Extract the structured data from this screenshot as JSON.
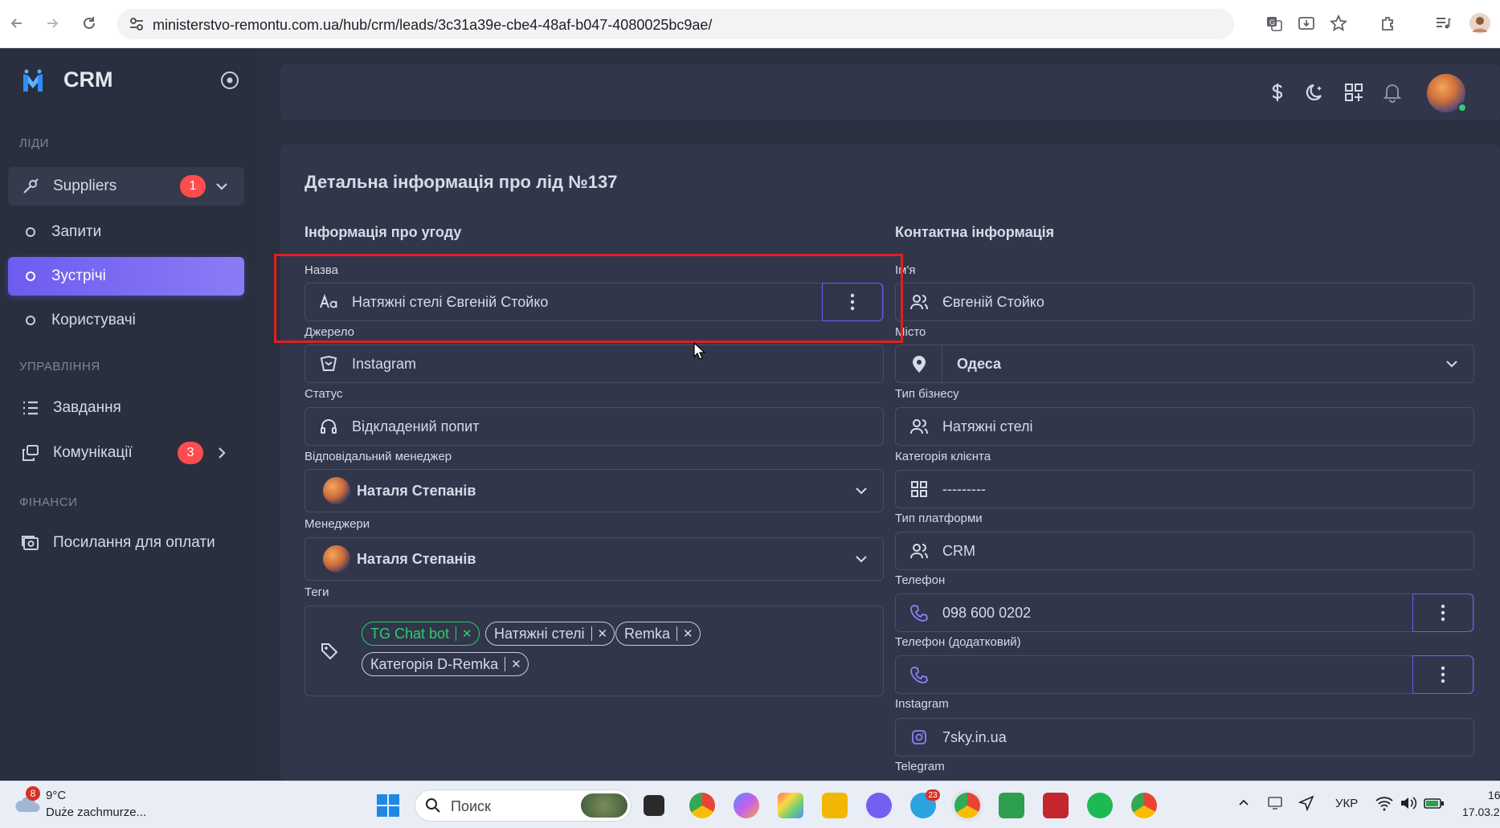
{
  "browser": {
    "url": "ministerstvo-remontu.com.ua/hub/crm/leads/3c31a39e-cbe4-48af-b047-4080025bc9ae/"
  },
  "sidebar": {
    "brand": "CRM",
    "sections": {
      "leads": "ЛІДИ",
      "management": "УПРАВЛІННЯ",
      "finance": "ФІНАНСИ"
    },
    "suppliers": {
      "label": "Suppliers",
      "badge": "1"
    },
    "sub_items": [
      "Запити",
      "Зустрічі",
      "Користувачі"
    ],
    "tasks": "Завдання",
    "communications": {
      "label": "Комунікації",
      "badge": "3"
    },
    "payment_links": "Посилання для оплати"
  },
  "page": {
    "title": "Детальна інформація про лід №137",
    "deal_title": "Інформація про угоду",
    "contact_title": "Контактна інформація"
  },
  "deal": {
    "name_label": "Назва",
    "name_value": "Натяжні стелі Євгеній Стойко",
    "source_label": "Джерело",
    "source_value": "Instagram",
    "status_label": "Статус",
    "status_value": "Відкладений попит",
    "manager_label": "Відповідальний менеджер",
    "manager_value": "Наталя Степанів",
    "managers_label": "Менеджери",
    "managers_value": "Наталя Степанів",
    "tags_label": "Теги",
    "tags": [
      "TG Chat bot",
      "Натяжні стелі",
      "Remka",
      "Категорія D-Remka"
    ]
  },
  "contact": {
    "name_label": "Ім'я",
    "name_value": "Євгеній Стойко",
    "city_label": "Місто",
    "city_value": "Одеса",
    "business_label": "Тип бізнесу",
    "business_value": "Натяжні стелі",
    "category_label": "Категорія клієнта",
    "category_value": "---------",
    "platform_label": "Тип платформи",
    "platform_value": "CRM",
    "phone_label": "Телефон",
    "phone_value": "098 600 0202",
    "phone2_label": "Телефон (додатковий)",
    "phone2_value": "",
    "instagram_label": "Instagram",
    "instagram_value": "7sky.in.ua",
    "telegram_label": "Telegram"
  },
  "taskbar": {
    "weather_badge": "8",
    "temperature": "9°C",
    "weather_text": "Duże zachmurze...",
    "search_placeholder": "Поиск",
    "telegram_badge": "23",
    "lang": "УКР",
    "clock_time": "16",
    "clock_date": "17.03.2"
  },
  "colors": {
    "accent": "#6d5cf0",
    "badge": "#ff4d4f",
    "tag_green": "#2ecc71",
    "highlight": "#e02020"
  }
}
